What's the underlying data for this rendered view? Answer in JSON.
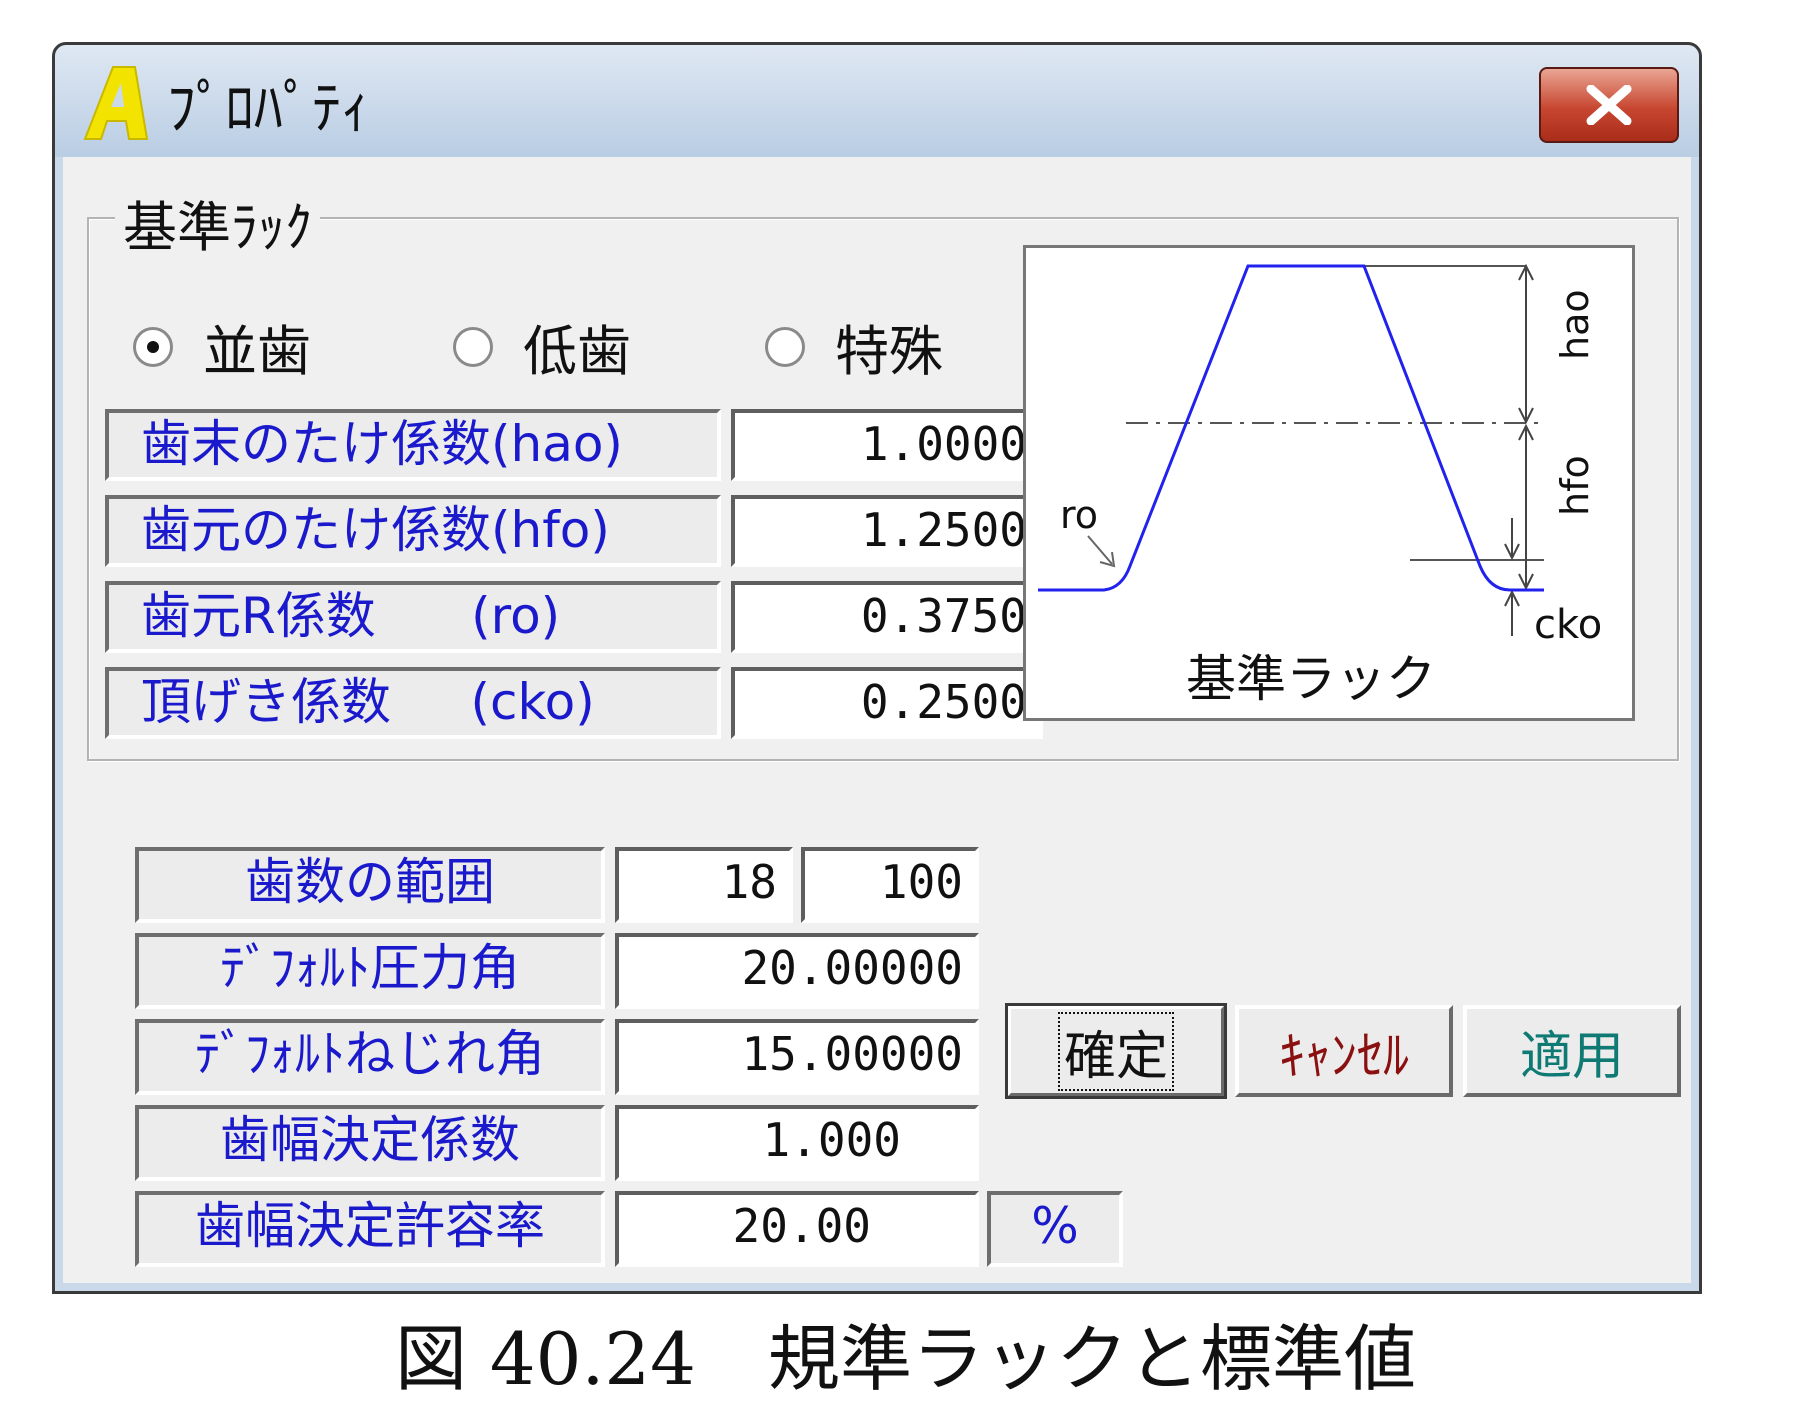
{
  "window": {
    "title": "ﾌﾟﾛﾊﾟﾃｨ",
    "app_icon": "letter-a-app-icon",
    "close_icon": "close-x-icon"
  },
  "group": {
    "title": "基準ﾗｯｸ",
    "radios": [
      {
        "label": "並歯",
        "selected": true
      },
      {
        "label": "低歯",
        "selected": false
      },
      {
        "label": "特殊",
        "selected": false
      }
    ],
    "params": [
      {
        "label": "歯末のたけ係数(hao)",
        "value": "1.0000"
      },
      {
        "label": "歯元のたけ係数(hfo)",
        "value": "1.2500"
      },
      {
        "label": "歯元R係数      (ro)",
        "value": "0.3750"
      },
      {
        "label": "頂げき係数     (cko)",
        "value": "0.2500"
      }
    ]
  },
  "diagram": {
    "caption": "基準ラック",
    "label_hao": "hao",
    "label_hfo": "hfo",
    "label_ro": "ro",
    "label_cko": "cko",
    "profile_color": "#2222ee"
  },
  "settings": {
    "teeth_range_label": "歯数の範囲",
    "teeth_min": "18",
    "teeth_max": "100",
    "pressure_angle_label": "ﾃﾞﾌｫﾙﾄ圧力角",
    "pressure_angle": "20.00000",
    "helix_angle_label": "ﾃﾞﾌｫﾙﾄねじれ角",
    "helix_angle": "15.00000",
    "face_width_factor_label": "歯幅決定係数",
    "face_width_factor": "1.000",
    "face_width_tolerance_label": "歯幅決定許容率",
    "face_width_tolerance": "20.00",
    "percent": "%"
  },
  "buttons": {
    "ok": "確定",
    "cancel": "ｷｬﾝｾﾙ",
    "apply": "適用",
    "cancel_color": "#8b1010",
    "apply_color": "#0f7a74"
  },
  "figure_caption": "図 40.24　規準ラックと標準値"
}
